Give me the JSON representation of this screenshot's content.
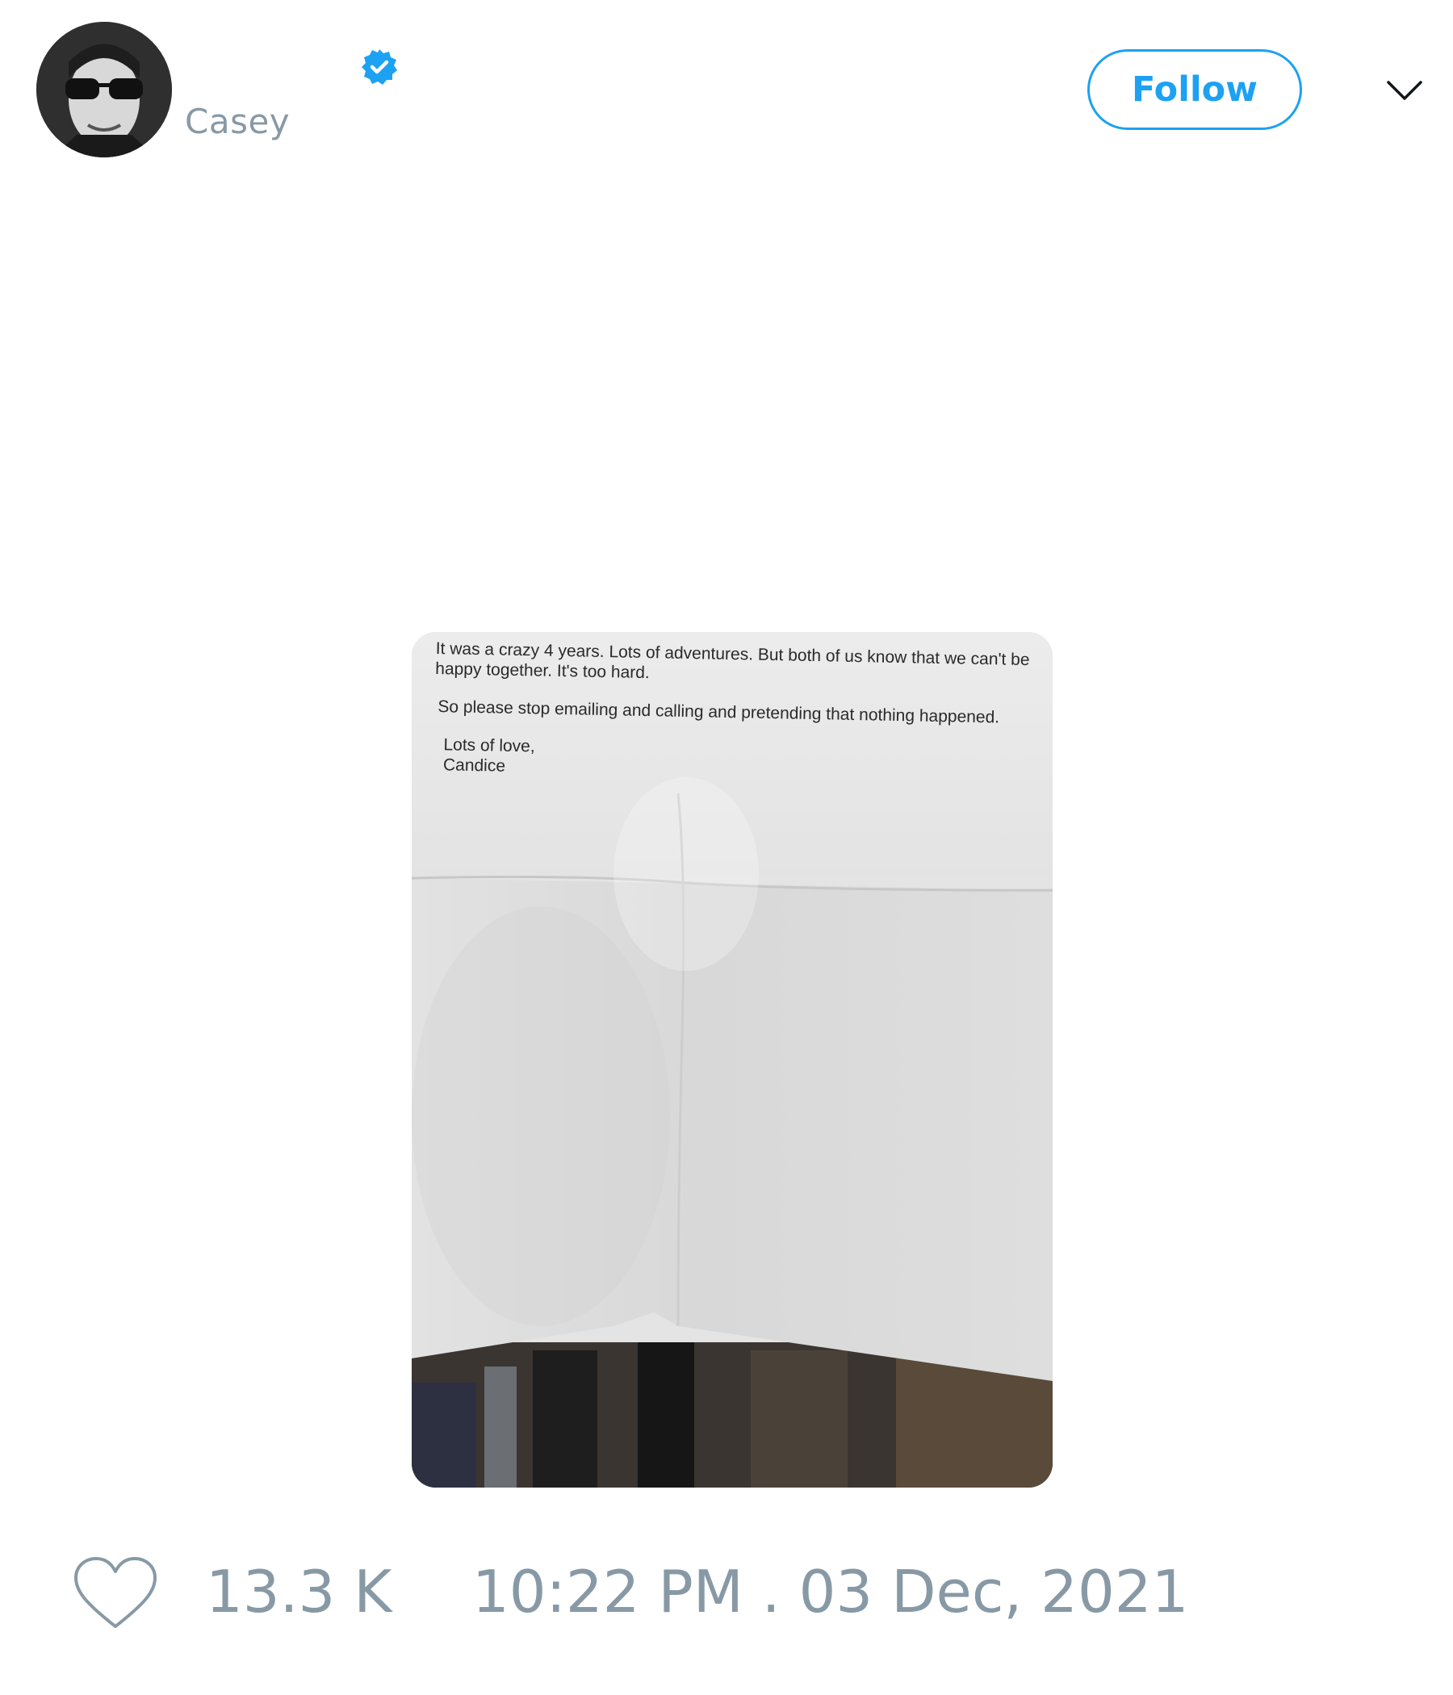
{
  "author": {
    "display_name": "Casey",
    "verified": true,
    "avatar_icon": "profile-photo-sunglasses"
  },
  "header": {
    "follow_label": "Follow",
    "menu_icon": "chevron-down-icon"
  },
  "media": {
    "letter_lines": {
      "paragraph1_line1": "It was a crazy 4 years.  Lots of adventures.  But both of us know that we can't be",
      "paragraph1_line2": "happy together.  It's too hard.",
      "paragraph2": "So please stop emailing and calling and pretending that nothing happened.",
      "closing": "Lots of love,",
      "signature": "Candice"
    }
  },
  "footer": {
    "like_icon": "heart-icon",
    "like_count": "13.3 K",
    "timestamp": "10:22 PM . 03 Dec, 2021"
  },
  "colors": {
    "accent": "#1da1f2",
    "muted_text": "#8899a6"
  }
}
